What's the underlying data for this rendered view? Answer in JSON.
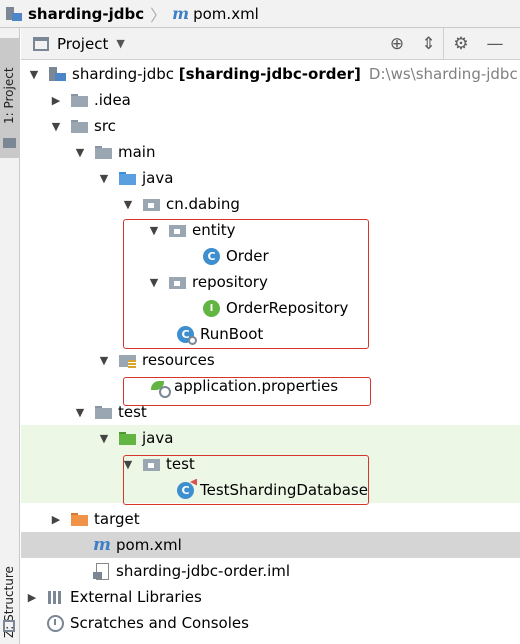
{
  "breadcrumb": {
    "project": "sharding-jdbc",
    "file": "pom.xml",
    "file_icon": "m"
  },
  "side_strip": {
    "project_tab": "1: Project",
    "structure_tab": "Z: Structure"
  },
  "project_header": {
    "title": "Project",
    "tools": [
      "locate-icon",
      "collapse-icon",
      "gear-icon",
      "hide-icon"
    ]
  },
  "tree": [
    {
      "label": "sharding-jdbc",
      "suffix": "[sharding-jdbc-order]",
      "path": "D:\\ws\\sharding-jdbc",
      "icon": "module-folder-icon",
      "expanded": true
    },
    {
      "label": ".idea",
      "icon": "folder-icon",
      "expanded": false
    },
    {
      "label": "src",
      "icon": "folder-icon",
      "expanded": true
    },
    {
      "label": "main",
      "icon": "folder-icon",
      "expanded": true
    },
    {
      "label": "java",
      "icon": "source-folder-icon",
      "expanded": true
    },
    {
      "label": "cn.dabing",
      "icon": "package-icon",
      "expanded": true
    },
    {
      "label": "entity",
      "icon": "package-icon",
      "expanded": true
    },
    {
      "label": "Order",
      "icon": "class-icon",
      "icon_letter": "C"
    },
    {
      "label": "repository",
      "icon": "package-icon",
      "expanded": true
    },
    {
      "label": "OrderRepository",
      "icon": "interface-icon",
      "icon_letter": "I"
    },
    {
      "label": "RunBoot",
      "icon": "spring-boot-class-icon",
      "icon_letter": "C"
    },
    {
      "label": "resources",
      "icon": "resources-folder-icon",
      "expanded": true
    },
    {
      "label": "application.properties",
      "icon": "properties-file-icon"
    },
    {
      "label": "test",
      "icon": "folder-icon",
      "expanded": true
    },
    {
      "label": "java",
      "icon": "test-source-folder-icon",
      "expanded": true
    },
    {
      "label": "test",
      "icon": "package-icon",
      "expanded": true
    },
    {
      "label": "TestShardingDatabase",
      "icon": "test-class-icon",
      "icon_letter": "C"
    },
    {
      "label": "target",
      "icon": "excluded-folder-icon",
      "expanded": false
    },
    {
      "label": "pom.xml",
      "icon": "maven-icon",
      "icon_letter": "m",
      "selected": true
    },
    {
      "label": "sharding-jdbc-order.iml",
      "icon": "iml-file-icon"
    },
    {
      "label": "External Libraries",
      "icon": "libraries-icon",
      "expanded": false
    },
    {
      "label": "Scratches and Consoles",
      "icon": "scratches-icon"
    }
  ],
  "colors": {
    "annotation": "#d6352c",
    "test_bg": "#edf7e6",
    "selected_bg": "#d5d5d5"
  }
}
